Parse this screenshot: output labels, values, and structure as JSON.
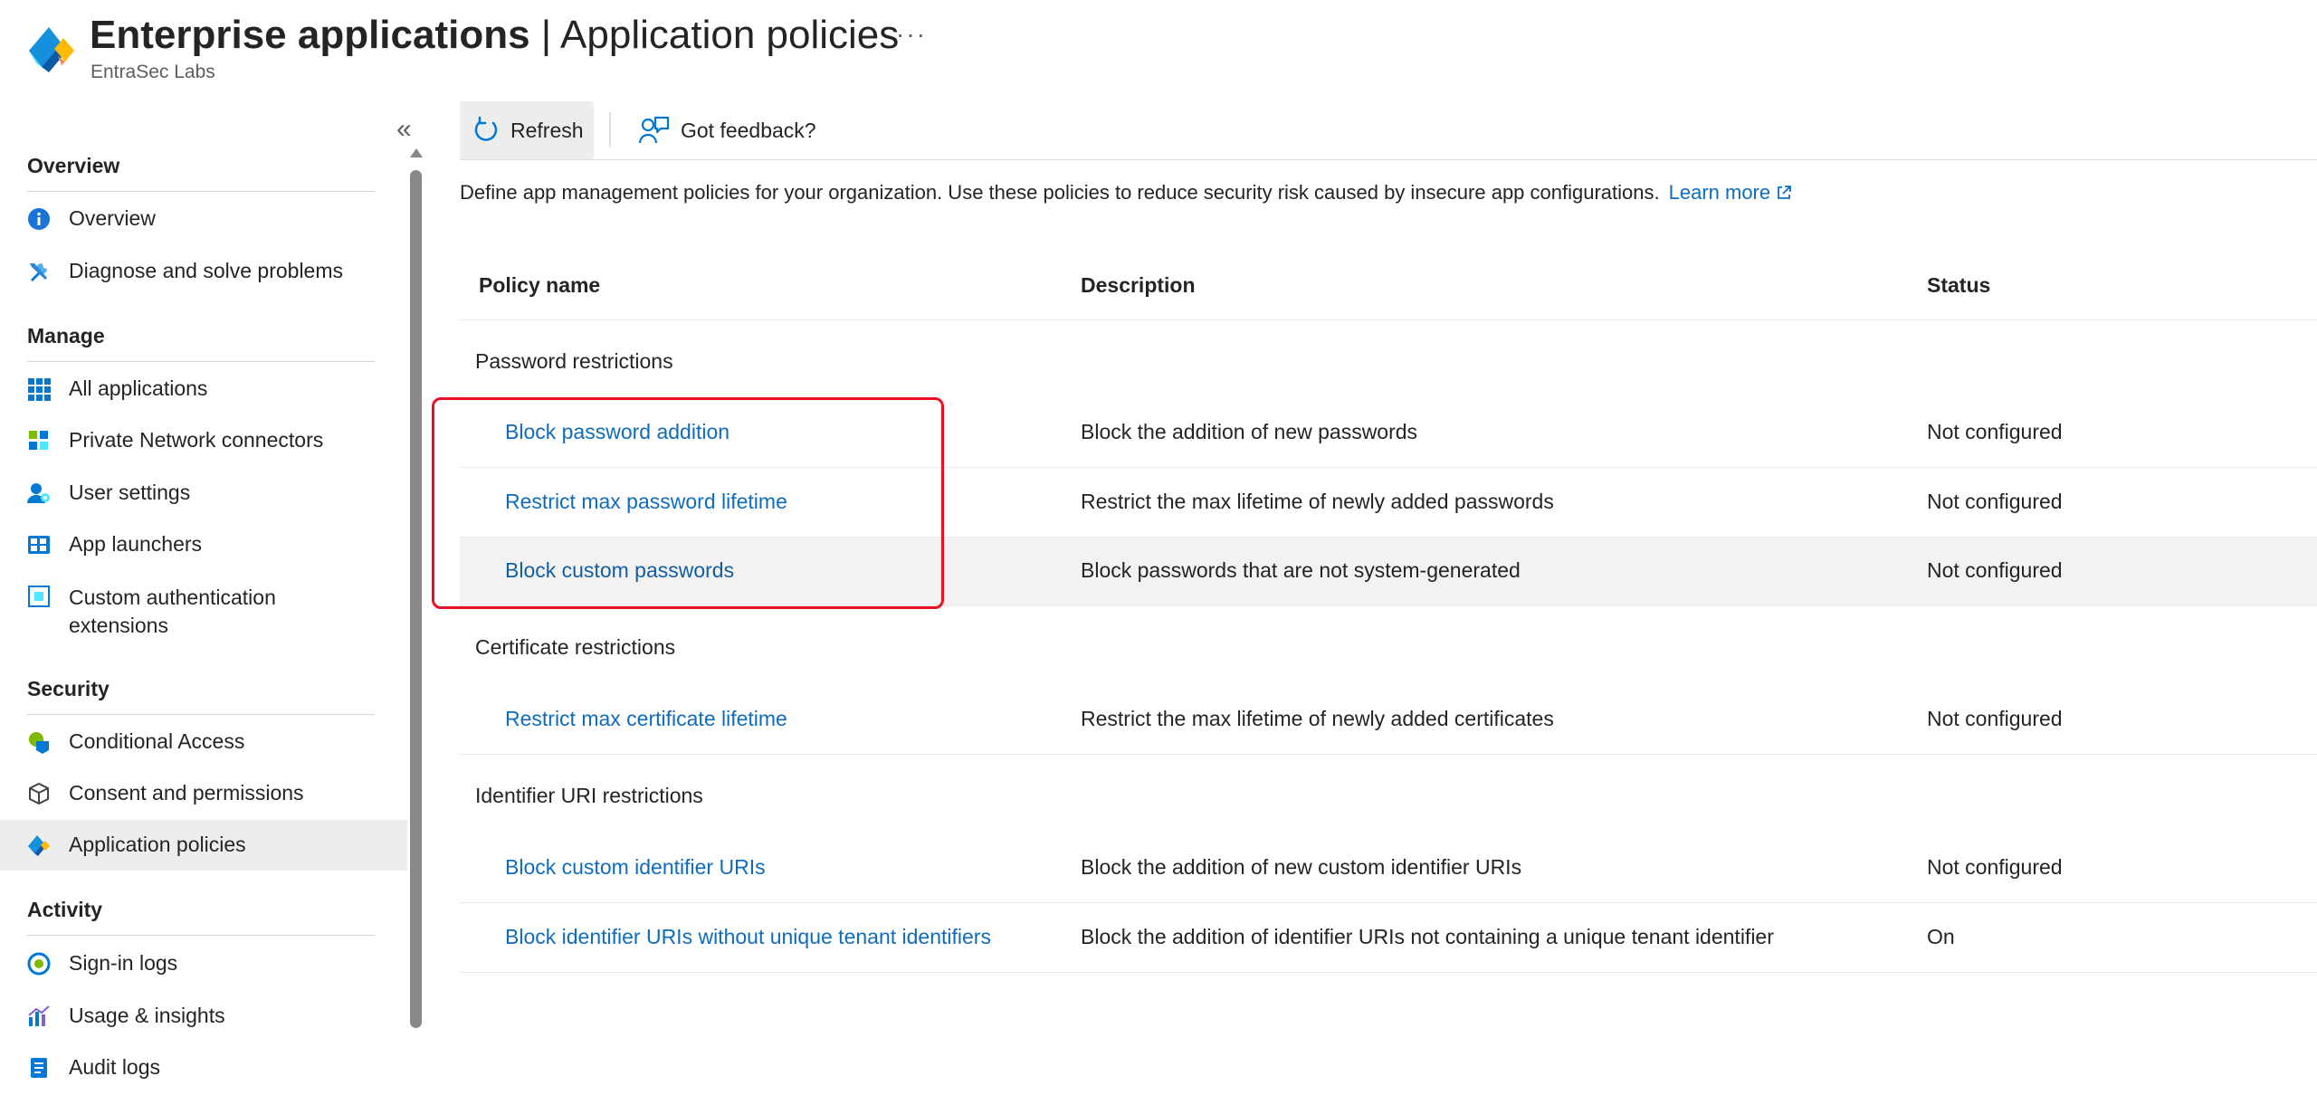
{
  "header": {
    "title_bold": "Enterprise applications",
    "title_separator": " | ",
    "title_rest": "Application policies",
    "subtitle": "EntraSec Labs",
    "more_label": "···"
  },
  "sidebar": {
    "collapse_label": "«",
    "sections": {
      "overview": "Overview",
      "manage": "Manage",
      "security": "Security",
      "activity": "Activity"
    },
    "items": [
      {
        "label": "Overview",
        "icon": "info-icon"
      },
      {
        "label": "Diagnose and solve problems",
        "icon": "wrench-icon"
      },
      {
        "label": "All applications",
        "icon": "grid-icon"
      },
      {
        "label": "Private Network connectors",
        "icon": "connector-icon"
      },
      {
        "label": "User settings",
        "icon": "user-settings-icon"
      },
      {
        "label": "App launchers",
        "icon": "app-launcher-icon"
      },
      {
        "label": "Custom authentication extensions",
        "icon": "extension-icon"
      },
      {
        "label": "Conditional Access",
        "icon": "conditional-access-icon"
      },
      {
        "label": "Consent and permissions",
        "icon": "cube-icon"
      },
      {
        "label": "Application policies",
        "icon": "application-policies-icon",
        "active": true
      },
      {
        "label": "Sign-in logs",
        "icon": "sign-in-logs-icon"
      },
      {
        "label": "Usage & insights",
        "icon": "chart-icon"
      },
      {
        "label": "Audit logs",
        "icon": "audit-logs-icon"
      }
    ]
  },
  "toolbar": {
    "refresh_label": "Refresh",
    "feedback_label": "Got feedback?"
  },
  "description": {
    "text": "Define app management policies for your organization. Use these policies to reduce security risk caused by insecure app configurations.",
    "learn_more": "Learn more"
  },
  "table": {
    "columns": [
      "Policy name",
      "Description",
      "Status"
    ],
    "groups": [
      {
        "name": "Password restrictions",
        "rows": [
          {
            "name": "Block password addition",
            "description": "Block the addition of new passwords",
            "status": "Not configured"
          },
          {
            "name": "Restrict max password lifetime",
            "description": "Restrict the max lifetime of newly added passwords",
            "status": "Not configured"
          },
          {
            "name": "Block custom passwords",
            "description": "Block passwords that are not system-generated",
            "status": "Not configured"
          }
        ]
      },
      {
        "name": "Certificate restrictions",
        "rows": [
          {
            "name": "Restrict max certificate lifetime",
            "description": "Restrict the max lifetime of newly added certificates",
            "status": "Not configured"
          }
        ]
      },
      {
        "name": "Identifier URI restrictions",
        "rows": [
          {
            "name": "Block custom identifier URIs",
            "description": "Block the addition of new custom identifier URIs",
            "status": "Not configured"
          },
          {
            "name": "Block identifier URIs without unique tenant identifiers",
            "description": "Block the addition of identifier URIs not containing a unique tenant identifier",
            "status": "On"
          }
        ]
      }
    ]
  },
  "colors": {
    "link": "#0f6cbd",
    "highlight_box": "#e81123",
    "active_nav": "#ededed"
  }
}
